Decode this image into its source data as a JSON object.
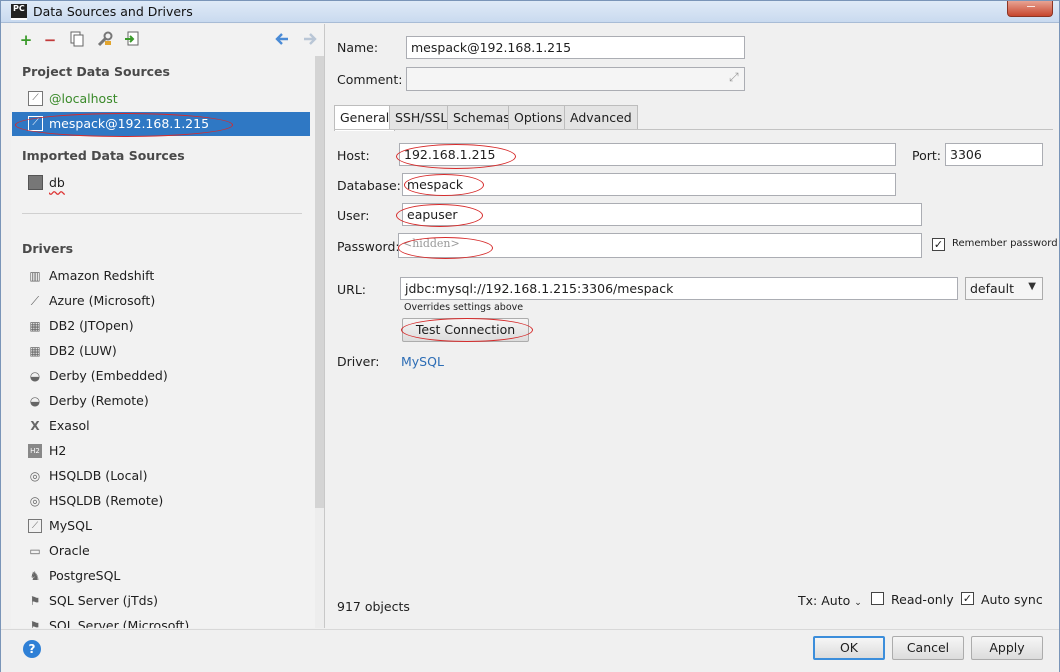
{
  "window": {
    "title": "Data Sources and Drivers"
  },
  "left": {
    "project_title": "Project Data Sources",
    "project_sources": [
      {
        "label": "@localhost",
        "color": "#3a8a2a"
      },
      {
        "label": "mespack@192.168.1.215",
        "selected": true
      }
    ],
    "imported_title": "Imported Data Sources",
    "imported_sources": [
      {
        "label": "db"
      }
    ],
    "drivers_title": "Drivers",
    "drivers": [
      {
        "label": "Amazon Redshift",
        "icon": "redshift-icon"
      },
      {
        "label": "Azure (Microsoft)",
        "icon": "azure-icon"
      },
      {
        "label": "DB2 (JTOpen)",
        "icon": "db2-icon"
      },
      {
        "label": "DB2 (LUW)",
        "icon": "db2-icon"
      },
      {
        "label": "Derby (Embedded)",
        "icon": "derby-icon"
      },
      {
        "label": "Derby (Remote)",
        "icon": "derby-icon"
      },
      {
        "label": "Exasol",
        "icon": "exasol-icon"
      },
      {
        "label": "H2",
        "icon": "h2-icon"
      },
      {
        "label": "HSQLDB (Local)",
        "icon": "hsqldb-icon"
      },
      {
        "label": "HSQLDB (Remote)",
        "icon": "hsqldb-icon"
      },
      {
        "label": "MySQL",
        "icon": "mysql-icon"
      },
      {
        "label": "Oracle",
        "icon": "oracle-icon"
      },
      {
        "label": "PostgreSQL",
        "icon": "postgresql-icon"
      },
      {
        "label": "SQL Server (jTds)",
        "icon": "sqlserver-icon"
      },
      {
        "label": "SQL Server (Microsoft)",
        "icon": "sqlserver-icon"
      }
    ]
  },
  "form": {
    "name_label": "Name:",
    "name_value": "mespack@192.168.1.215",
    "comment_label": "Comment:",
    "comment_value": "",
    "tabs": [
      "General",
      "SSH/SSL",
      "Schemas",
      "Options",
      "Advanced"
    ],
    "active_tab": "General",
    "host_label": "Host:",
    "host_value": "192.168.1.215",
    "port_label": "Port:",
    "port_value": "3306",
    "database_label": "Database:",
    "database_value": "mespack",
    "user_label": "User:",
    "user_value": "eapuser",
    "password_label": "Password:",
    "password_placeholder": "<hidden>",
    "remember_password_label": "Remember password",
    "remember_password_checked": true,
    "url_label": "URL:",
    "url_value": "jdbc:mysql://192.168.1.215:3306/mespack",
    "url_mode": "default",
    "overrides_note": "Overrides settings above",
    "test_connection_label": "Test Connection",
    "driver_label": "Driver:",
    "driver_value": "MySQL",
    "objects_count": "917 objects",
    "tx_label": "Tx: Auto",
    "readonly_label": "Read-only",
    "readonly_checked": false,
    "autosync_label": "Auto sync",
    "autosync_checked": true
  },
  "buttons": {
    "ok": "OK",
    "cancel": "Cancel",
    "apply": "Apply",
    "help": "?"
  },
  "colors": {
    "selection": "#2f78c4",
    "link": "#2d6db5",
    "annotation": "#d62b2b"
  }
}
